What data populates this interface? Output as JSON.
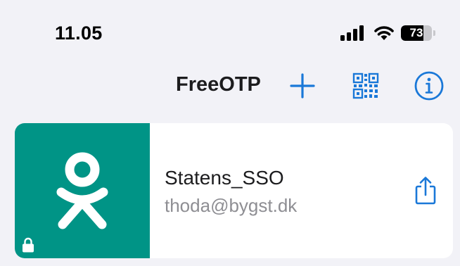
{
  "status_bar": {
    "time": "11.05",
    "battery_level": "73",
    "battery_fraction": 0.73,
    "icons": [
      "cellular-signal-icon",
      "wifi-icon",
      "battery-icon"
    ]
  },
  "nav": {
    "title": "FreeOTP",
    "actions": [
      {
        "icon": "plus-icon"
      },
      {
        "icon": "qr-code-icon"
      },
      {
        "icon": "info-icon"
      }
    ]
  },
  "tokens": [
    {
      "issuer": "Statens_SSO",
      "account": "thoda@bygst.dk",
      "logo_icon": "odnoklassniki-logo-icon",
      "locked_icon": "lock-icon",
      "action_icon": "share-icon",
      "logo_background": "#009486"
    }
  ],
  "colors": {
    "accent": "#1a78d8",
    "background": "#f2f2f7",
    "card": "#ffffff",
    "secondary_text": "#8e8e93"
  }
}
